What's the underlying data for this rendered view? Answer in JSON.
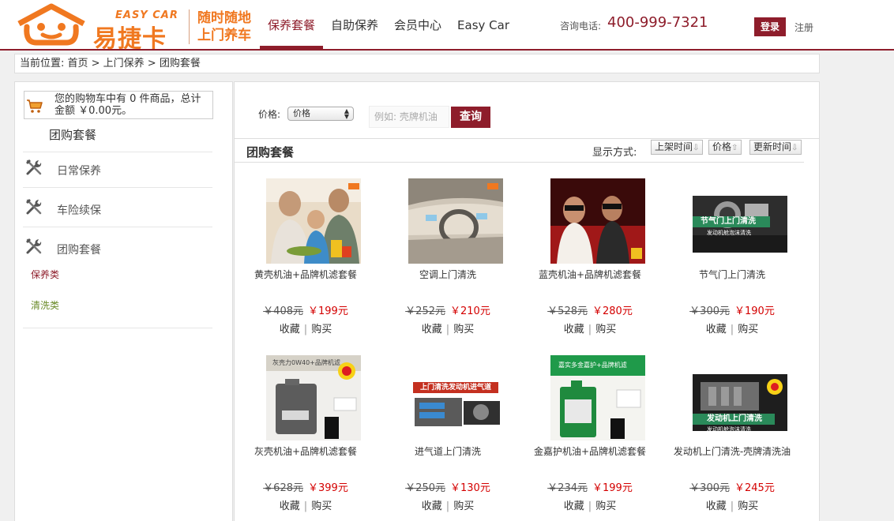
{
  "header": {
    "logo_en": "EASY CAR",
    "logo_cn": "易捷卡",
    "slogan_line1": "随时随地",
    "slogan_line2": "上门养车",
    "nav": [
      "保养套餐",
      "自助保养",
      "会员中心",
      "Easy Car"
    ],
    "hotline_label": "咨询电话:",
    "hotline_number": "400-999-7321",
    "login": "登录",
    "register": "注册"
  },
  "breadcrumb": "当前位置: 首页 > 上门保养 > 团购套餐",
  "sidebar": {
    "cart_text": "您的购物车中有 0 件商品，总计金额 ￥0.00元。",
    "title": "团购套餐",
    "items": [
      "日常保养",
      "车险续保",
      "团购套餐"
    ],
    "subitems": [
      "保养类",
      "清洗类"
    ]
  },
  "filter": {
    "price_label": "价格:",
    "price_selected": "价格",
    "search_placeholder": "例如: 壳牌机油",
    "search_button": "查询"
  },
  "list": {
    "title": "团购套餐",
    "sort_label": "显示方式:",
    "sort_options": [
      "上架时间",
      "价格",
      "更新时间"
    ]
  },
  "products": [
    {
      "name": "黄壳机油+品牌机滤套餐",
      "old_price": "￥408元",
      "new_price": "￥199元",
      "image": "family-dinner-photo"
    },
    {
      "name": "空调上门清洗",
      "old_price": "￥252元",
      "new_price": "￥210元",
      "image": "car-interior-photo"
    },
    {
      "name": "蓝壳机油+品牌机滤套餐",
      "old_price": "￥528元",
      "new_price": "￥280元",
      "image": "cinema-3d-photo"
    },
    {
      "name": "节气门上门清洗",
      "old_price": "￥300元",
      "new_price": "￥190元",
      "image": "throttle-body-photo",
      "banner": "节气门上门清洗",
      "sub": "发动机舱泡沫清洗"
    },
    {
      "name": "灰壳机油+品牌机滤套餐",
      "old_price": "￥628元",
      "new_price": "￥399元",
      "image": "helix-oil-photo",
      "banner": "灰壳力0W40+品牌机滤"
    },
    {
      "name": "进气道上门清洗",
      "old_price": "￥250元",
      "new_price": "￥130元",
      "image": "intake-cleaning-photo",
      "banner": "上门清洗发动机进气道"
    },
    {
      "name": "金嘉护机油+品牌机滤套餐",
      "old_price": "￥234元",
      "new_price": "￥199元",
      "image": "castrol-oil-photo",
      "banner": "嘉实多金嘉护+品牌机滤"
    },
    {
      "name": "发动机上门清洗-壳牌清洗油",
      "old_price": "￥300元",
      "new_price": "￥245元",
      "image": "engine-wash-photo",
      "banner": "发动机上门清洗",
      "sub": "发动机舱泡沫清洗"
    }
  ],
  "product_actions": {
    "favorite": "收藏",
    "buy": "购买"
  }
}
